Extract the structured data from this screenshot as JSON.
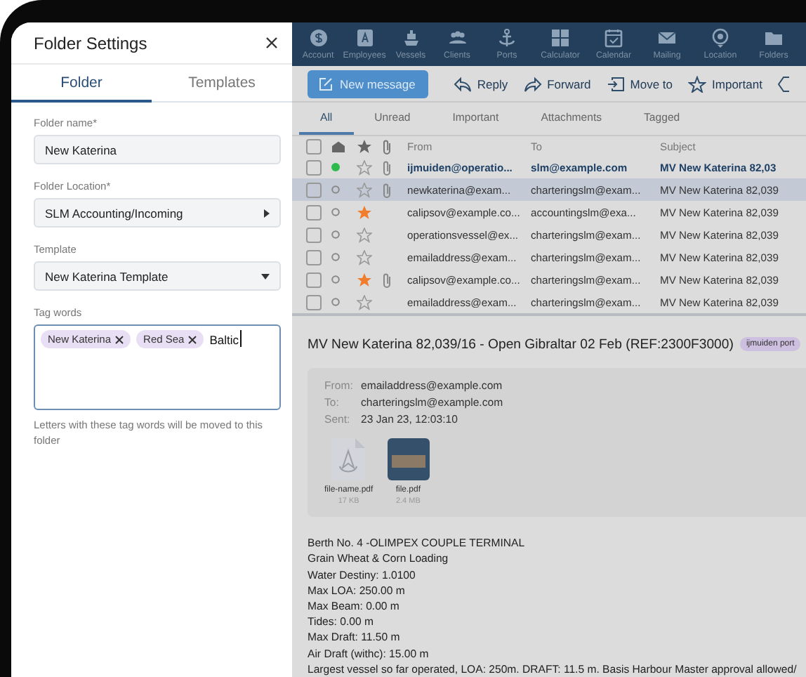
{
  "panel": {
    "title": "Folder Settings",
    "tabs": [
      {
        "label": "Folder",
        "selected": true
      },
      {
        "label": "Templates",
        "selected": false
      }
    ],
    "fields": [
      {
        "kind": "text",
        "label": "Folder name*",
        "value": "New Katerina"
      },
      {
        "kind": "menu",
        "label": "Folder Location*",
        "value": "SLM Accounting/Incoming"
      },
      {
        "kind": "dropdown",
        "label": "Template",
        "value": "New Katerina Template"
      }
    ],
    "tag_field": {
      "label": "Tag words",
      "tags": [
        "New Katerina",
        "Red Sea"
      ],
      "value": "Baltic",
      "hint": "Letters with these tag words will be moved to this folder"
    }
  },
  "nav": [
    "Account",
    "Employees",
    "Vessels",
    "Clients",
    "Ports",
    "Calculator",
    "Calendar",
    "Mailing",
    "Location",
    "Folders"
  ],
  "toolbar": {
    "primary": "New message",
    "actions": [
      "Reply",
      "Forward",
      "Move to",
      "Important"
    ]
  },
  "filters": [
    {
      "label": "All",
      "selected": true
    },
    {
      "label": "Unread",
      "selected": false
    },
    {
      "label": "Important",
      "selected": false
    },
    {
      "label": "Attachments",
      "selected": false
    },
    {
      "label": "Tagged",
      "selected": false
    }
  ],
  "table": {
    "all_checked": false,
    "columns": [
      "From",
      "To",
      "Subject"
    ],
    "rows": [
      {
        "from": "ijmuiden@operatio...",
        "to": "slm@example.com",
        "subject": "MV New Katerina 82,03",
        "checked": false,
        "unread": true,
        "starred": false,
        "attachment": true,
        "selected": false
      },
      {
        "from": "newkaterina@exam...",
        "to": "charteringslm@exam...",
        "subject": "MV New Katerina 82,039",
        "checked": false,
        "unread": false,
        "starred": false,
        "attachment": true,
        "selected": true
      },
      {
        "from": "calipsov@example.co...",
        "to": "accountingslm@exa...",
        "subject": "MV New Katerina 82,039",
        "checked": false,
        "unread": false,
        "starred": true,
        "attachment": false,
        "selected": false
      },
      {
        "from": "operationsvessel@ex...",
        "to": "charteringslm@exam...",
        "subject": "MV New Katerina 82,039",
        "checked": false,
        "unread": false,
        "starred": false,
        "attachment": false,
        "selected": false
      },
      {
        "from": "emailaddress@exam...",
        "to": "charteringslm@exam...",
        "subject": "MV New Katerina 82,039",
        "checked": false,
        "unread": false,
        "starred": false,
        "attachment": false,
        "selected": false
      },
      {
        "from": "calipsov@example.co...",
        "to": "charteringslm@exam...",
        "subject": "MV New Katerina 82,039",
        "checked": false,
        "unread": false,
        "starred": true,
        "attachment": true,
        "selected": false
      },
      {
        "from": "emailaddress@exam...",
        "to": "charteringslm@exam...",
        "subject": "MV New Katerina 82,039",
        "checked": false,
        "unread": false,
        "starred": false,
        "attachment": false,
        "selected": false
      }
    ]
  },
  "message": {
    "subject": "MV New Katerina 82,039/16 - Open Gibraltar 02 Feb (REF:2300F3000)",
    "tag": "ijmuiden port",
    "meta": [
      {
        "label": "From:",
        "value": "emailaddress@example.com"
      },
      {
        "label": "To:",
        "value": "charteringslm@example.com"
      },
      {
        "label": "Sent:",
        "value": "23 Jan 23, 12:03:10"
      }
    ],
    "attachments": [
      {
        "kind": "document",
        "name": "file-name.pdf",
        "size": "17 KB"
      },
      {
        "kind": "photo",
        "name": "file.pdf",
        "size": "2.4 MB"
      }
    ],
    "body": [
      "Berth No. 4 -OLIMPEX COUPLE TERMINAL",
      "Grain Wheat & Corn Loading",
      "Water Destiny: 1.0100",
      "Max LOA: 250.00 m",
      "Max Beam: 0.00 m",
      "Tides: 0.00 m",
      "Max Draft: 11.50 m",
      "Air Draft (withc): 15.00 m",
      "Largest vessel so far operated, LOA: 250m. DRAFT: 11.5 m. Basis Harbour Master approval allowed/"
    ]
  }
}
